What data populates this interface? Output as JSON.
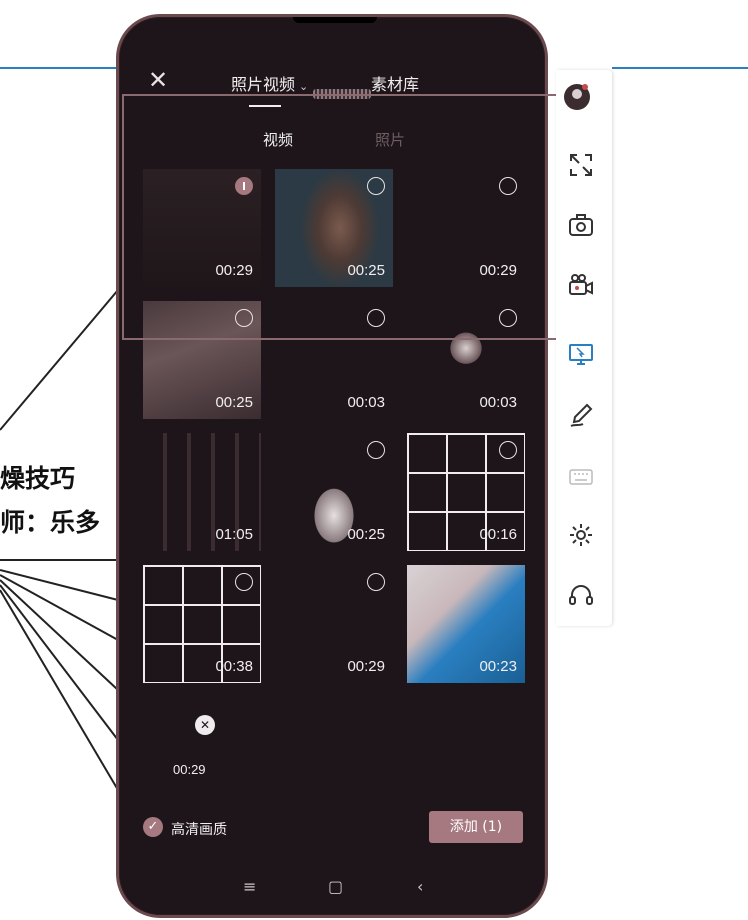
{
  "background": {
    "slide_text_1": "燥技巧",
    "slide_text_2": "师：乐多"
  },
  "header": {
    "close_icon": "close-icon",
    "tab_photos_video": "照片视频",
    "tab_library": "素材库"
  },
  "subtabs": {
    "video": "视频",
    "photo": "照片"
  },
  "grid": [
    {
      "duration": "00:29",
      "selected": true
    },
    {
      "duration": "00:25",
      "selected": false
    },
    {
      "duration": "00:29",
      "selected": false
    },
    {
      "duration": "00:25",
      "selected": false
    },
    {
      "duration": "00:03",
      "selected": false
    },
    {
      "duration": "00:03",
      "selected": false
    },
    {
      "duration": "01:05",
      "selected": false
    },
    {
      "duration": "00:25",
      "selected": false
    },
    {
      "duration": "00:16",
      "selected": false
    },
    {
      "duration": "00:38",
      "selected": false
    },
    {
      "duration": "00:29",
      "selected": false
    },
    {
      "duration": "00:23",
      "selected": false
    },
    {
      "duration": "00:29",
      "selected": false
    }
  ],
  "bottom": {
    "hq_label": "高清画质",
    "add_label": "添加 (1)"
  },
  "colors": {
    "accent": "#a6787f",
    "phone_bg": "#1d1519",
    "toolbar_blue": "#2a7fc0"
  },
  "toolbar": [
    {
      "icon": "avatar"
    },
    {
      "icon": "fullscreen-icon"
    },
    {
      "icon": "camera-icon"
    },
    {
      "icon": "video-camera-icon"
    },
    {
      "icon": "screen-pointer-icon"
    },
    {
      "icon": "pen-icon"
    },
    {
      "icon": "keyboard-icon"
    },
    {
      "icon": "settings-gear-icon"
    },
    {
      "icon": "headset-icon"
    }
  ]
}
